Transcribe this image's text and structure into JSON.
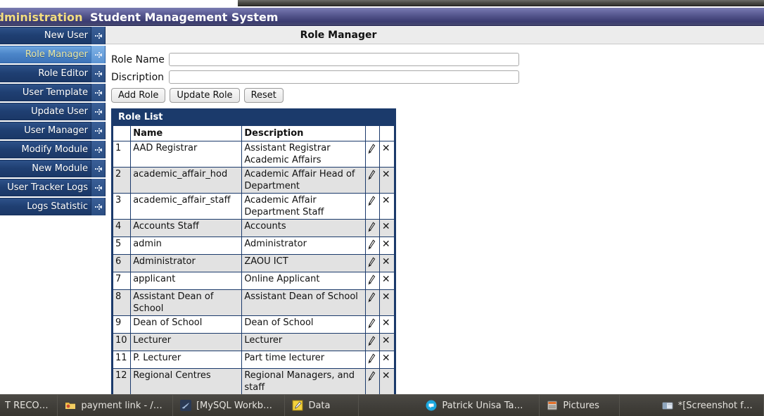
{
  "header": {
    "admin_label": "Administration",
    "system_title": "Student Management System"
  },
  "sidebar": {
    "items": [
      {
        "label": "New User",
        "active": false
      },
      {
        "label": "Role Manager",
        "active": true
      },
      {
        "label": "Role Editor",
        "active": false
      },
      {
        "label": "User Template",
        "active": false
      },
      {
        "label": "Update User",
        "active": false
      },
      {
        "label": "User Manager",
        "active": false
      },
      {
        "label": "Modify Module",
        "active": false
      },
      {
        "label": "New Module",
        "active": false
      },
      {
        "label": "User Tracker Logs",
        "active": false
      },
      {
        "label": "Logs Statistic",
        "active": false
      }
    ]
  },
  "main": {
    "page_title": "Role Manager",
    "form": {
      "role_name_label": "Role Name",
      "role_name_value": "",
      "description_label": "Discription",
      "description_value": "",
      "buttons": [
        {
          "label": "Add Role",
          "name": "add-role-button"
        },
        {
          "label": "Update Role",
          "name": "update-role-button"
        },
        {
          "label": "Reset",
          "name": "reset-button"
        }
      ]
    },
    "table": {
      "caption": "Role List",
      "columns": [
        "",
        "Name",
        "Description",
        "",
        ""
      ],
      "rows": [
        {
          "num": "1",
          "name": "AAD Registrar",
          "description": "Assistant Registrar Academic Affairs"
        },
        {
          "num": "2",
          "name": "academic_affair_hod",
          "description": "Academic Affair Head of Department"
        },
        {
          "num": "3",
          "name": "academic_affair_staff",
          "description": "Academic Affair Department Staff"
        },
        {
          "num": "4",
          "name": "Accounts Staff",
          "description": "Accounts"
        },
        {
          "num": "5",
          "name": "admin",
          "description": "Administrator"
        },
        {
          "num": "6",
          "name": "Administrator",
          "description": "ZAOU ICT"
        },
        {
          "num": "7",
          "name": "applicant",
          "description": "Online Applicant"
        },
        {
          "num": "8",
          "name": "Assistant Dean of School",
          "description": "Assistant Dean of School"
        },
        {
          "num": "9",
          "name": "Dean of School",
          "description": "Dean of School"
        },
        {
          "num": "10",
          "name": "Lecturer",
          "description": "Lecturer"
        },
        {
          "num": "11",
          "name": "P. Lecturer",
          "description": "Part time lecturer"
        },
        {
          "num": "12",
          "name": "Regional Centres",
          "description": "Regional Managers, and staff"
        }
      ],
      "row_actions": {
        "edit_icon": "pencil-icon",
        "delete_icon": "close-x-icon",
        "delete_glyph": "✕"
      }
    }
  },
  "taskbar": {
    "items": [
      {
        "label": "T RECO…",
        "icon": "document-icon"
      },
      {
        "label": "payment link - /h…",
        "icon": "folder-icon"
      },
      {
        "label": "[MySQL Workbe…",
        "icon": "mysql-workbench-icon"
      },
      {
        "label": "Data",
        "icon": "notepad-edit-icon"
      },
      {
        "label": "Patrick Unisa Ta…",
        "icon": "chat-bubble-icon"
      },
      {
        "label": "Pictures",
        "icon": "file-manager-icon"
      },
      {
        "label": "*[Screenshot fr…",
        "icon": "image-viewer-icon"
      }
    ]
  },
  "colors": {
    "header_purple": "#4e4f86",
    "sidebar_blue": "#1f3f72",
    "sidebar_active_blue": "#4c86c9",
    "active_text_yellow": "#e9e8a6",
    "table_border_navy": "#1b3a6b",
    "alt_row_gray": "#e2e2e2",
    "taskbar_gray": "#413f3a"
  }
}
